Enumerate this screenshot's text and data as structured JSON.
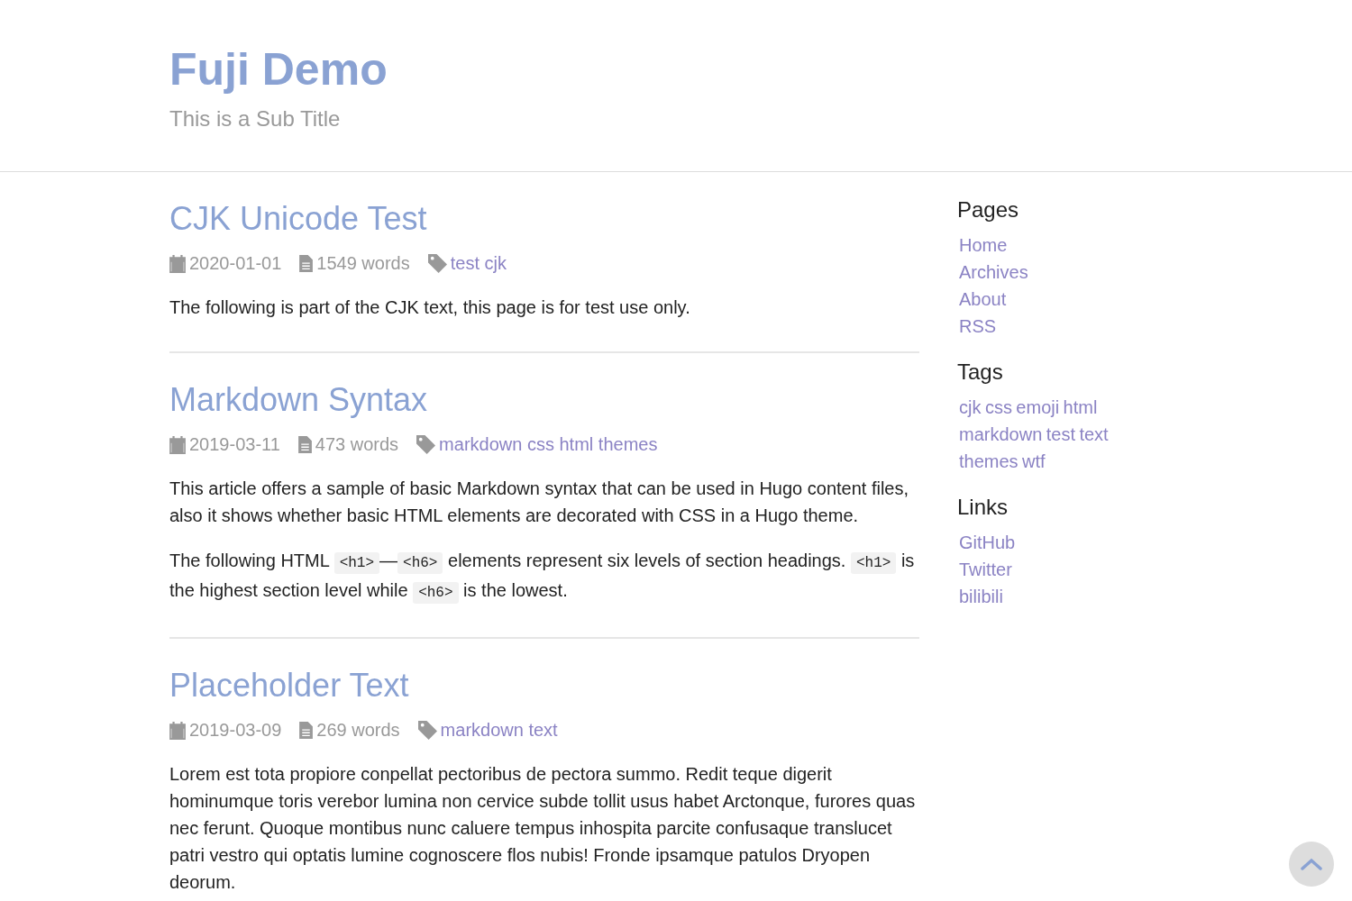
{
  "site": {
    "title": "Fuji Demo",
    "subtitle": "This is a Sub Title"
  },
  "posts": [
    {
      "title": "CJK Unicode Test",
      "date": "2020-01-01",
      "words": "1549 words",
      "tags": [
        "test",
        "cjk"
      ],
      "paragraphs": [
        [
          {
            "kind": "text",
            "text": "The following is part of the CJK text, this page is for test use only."
          }
        ]
      ]
    },
    {
      "title": "Markdown Syntax",
      "date": "2019-03-11",
      "words": "473 words",
      "tags": [
        "markdown",
        "css",
        "html",
        "themes"
      ],
      "paragraphs": [
        [
          {
            "kind": "text",
            "text": "This article offers a sample of basic Markdown syntax that can be used in Hugo content files, also it shows whether basic HTML elements are decorated with CSS in a Hugo theme."
          }
        ],
        [
          {
            "kind": "text",
            "text": "The following HTML "
          },
          {
            "kind": "code",
            "text": "<h1>"
          },
          {
            "kind": "text",
            "text": "—"
          },
          {
            "kind": "code",
            "text": "<h6>"
          },
          {
            "kind": "text",
            "text": " elements represent six levels of section headings. "
          },
          {
            "kind": "code",
            "text": "<h1>"
          },
          {
            "kind": "text",
            "text": " is the highest section level while "
          },
          {
            "kind": "code",
            "text": "<h6>"
          },
          {
            "kind": "text",
            "text": " is the lowest."
          }
        ]
      ]
    },
    {
      "title": "Placeholder Text",
      "date": "2019-03-09",
      "words": "269 words",
      "tags": [
        "markdown",
        "text"
      ],
      "paragraphs": [
        [
          {
            "kind": "text",
            "text": "Lorem est tota propiore conpellat pectoribus de pectora summo. Redit teque digerit hominumque toris verebor lumina non cervice subde tollit usus habet Arctonque, furores quas nec ferunt. Quoque montibus nunc caluere tempus inhospita parcite confusaque translucet patri vestro qui optatis lumine cognoscere flos nubis! Fronde ipsamque patulos Dryopen deorum."
          }
        ]
      ]
    }
  ],
  "sidebar": [
    {
      "heading": "Pages",
      "kind": "list",
      "links": [
        "Home",
        "Archives",
        "About",
        "RSS"
      ]
    },
    {
      "heading": "Tags",
      "kind": "inline",
      "links": [
        "cjk",
        "css",
        "emoji",
        "html",
        "markdown",
        "test",
        "text",
        "themes",
        "wtf"
      ]
    },
    {
      "heading": "Links",
      "kind": "list",
      "links": [
        "GitHub",
        "Twitter",
        "bilibili"
      ]
    }
  ]
}
